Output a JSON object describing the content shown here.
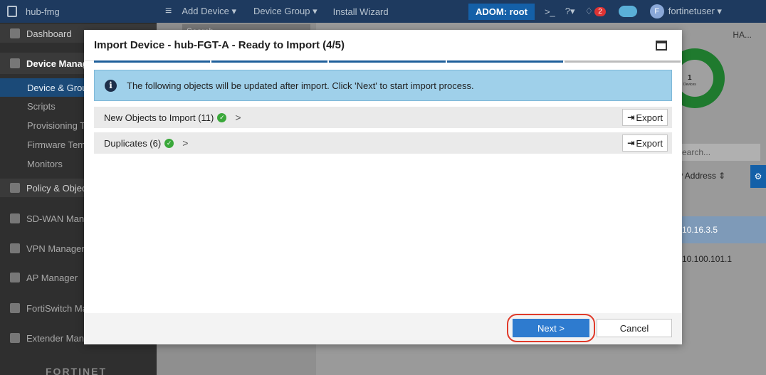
{
  "topbar": {
    "app_name": "hub-fmg",
    "add_device": "Add Device",
    "device_group": "Device Group",
    "install_wizard": "Install Wizard",
    "adom": "ADOM: root",
    "alert_count": "2",
    "user": "fortinetuser",
    "user_initial": "F"
  },
  "sidebar": {
    "items": [
      {
        "label": "Dashboard"
      },
      {
        "label": "Device Manager"
      },
      {
        "label": "Device & Groups"
      },
      {
        "label": "Scripts"
      },
      {
        "label": "Provisioning Templates"
      },
      {
        "label": "Firmware Templates"
      },
      {
        "label": "Monitors"
      },
      {
        "label": "Policy & Objects"
      },
      {
        "label": "SD-WAN Manager"
      },
      {
        "label": "VPN Manager"
      },
      {
        "label": "AP Manager"
      },
      {
        "label": "FortiSwitch Manager"
      },
      {
        "label": "Extender Manager"
      }
    ],
    "logo": "FORTINET"
  },
  "background": {
    "search_placeholder": "Search",
    "right_search_placeholder": "Search...",
    "ha_label": "HA...",
    "donut_count": "1",
    "donut_caption": "Devices",
    "ip_header": "IP Address",
    "ip_rows": [
      "10.16.3.5",
      "10.100.101.1"
    ]
  },
  "dialog": {
    "title": "Import Device - hub-FGT-A - Ready to Import (4/5)",
    "info": "The following objects will be updated after import. Click 'Next' to start import process.",
    "rows": [
      {
        "label": "New Objects to Import (11)",
        "export": "Export"
      },
      {
        "label": "Duplicates (6)",
        "export": "Export"
      }
    ],
    "next": "Next >",
    "cancel": "Cancel"
  },
  "colors": {
    "accent": "#2e7bcf",
    "highlight": "#e03a2a",
    "info_bg": "#9fd0ea",
    "check": "#3aa83a"
  }
}
